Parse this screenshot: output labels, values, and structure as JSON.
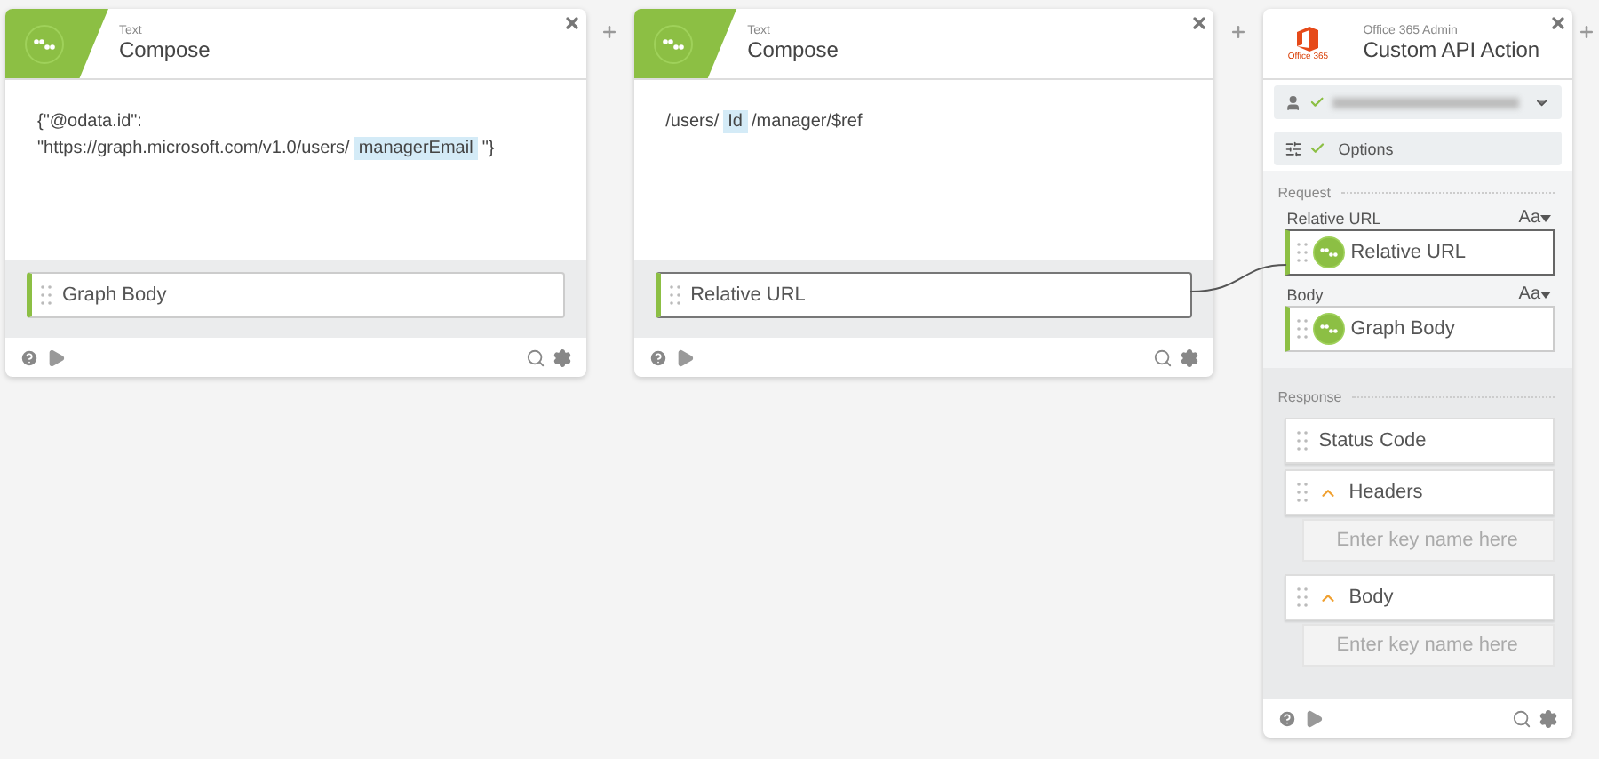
{
  "canvas_cards": [
    {
      "category": "Text",
      "title": "Compose",
      "body": [
        {
          "kind": "text",
          "text": "{\"@odata.id\": \"https://graph.microsoft.com/v1.0/users/"
        },
        {
          "kind": "token",
          "text": "managerEmail"
        },
        {
          "kind": "text",
          "text": "\"}"
        }
      ],
      "output": {
        "label": "Graph Body",
        "selected": false
      }
    },
    {
      "category": "Text",
      "title": "Compose",
      "body": [
        {
          "kind": "text",
          "text": "/users/"
        },
        {
          "kind": "token",
          "text": "Id"
        },
        {
          "kind": "text",
          "text": "/manager/$ref"
        }
      ],
      "output": {
        "label": "Relative URL",
        "selected": true
      }
    }
  ],
  "action": {
    "logo_label": "Office 365",
    "category": "Office 365 Admin",
    "title": "Custom API Action",
    "account": {
      "verified": true
    },
    "options": {
      "label": "Options",
      "verified": true
    },
    "request": {
      "heading": "Request",
      "fields": [
        {
          "label": "Relative URL",
          "format": "Aa",
          "value": "Relative URL",
          "selected": true
        },
        {
          "label": "Body",
          "format": "Aa",
          "value": "Graph Body",
          "selected": false
        }
      ]
    },
    "response": {
      "heading": "Response",
      "items": [
        {
          "label": "Status Code",
          "kind": "plain"
        },
        {
          "label": "Headers",
          "kind": "object",
          "expanded": true,
          "children": [
            {
              "placeholder": "Enter key name here"
            }
          ]
        },
        {
          "label": "Body",
          "kind": "object",
          "expanded": true,
          "children": [
            {
              "placeholder": "Enter key name here"
            }
          ]
        }
      ]
    }
  }
}
